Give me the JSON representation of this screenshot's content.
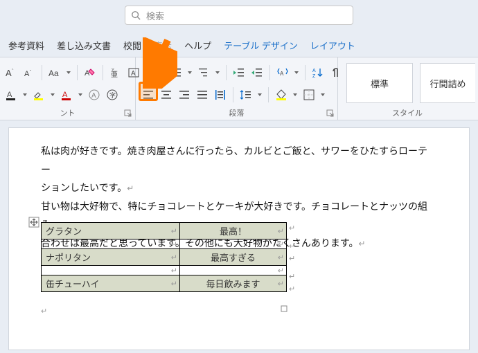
{
  "search": {
    "placeholder": "検索"
  },
  "tabs": [
    "参考資料",
    "差し込み文書",
    "校閲",
    "表示",
    "ヘルプ",
    "テーブル デザイン",
    "レイアウト"
  ],
  "groups": {
    "font": "ント",
    "para": "段落",
    "style": "スタイル"
  },
  "style": {
    "normal": "標準",
    "nospacing": "行間詰め"
  },
  "body": {
    "p1a": "私は肉が好きです。焼き肉屋さんに行ったら、カルビとご飯と、サワーをひたすらローテー",
    "p1b": "ションしたいです。",
    "p2a": "甘い物は大好物で、特にチョコレートとケーキが大好きです。チョコレートとナッツの組み",
    "p2b": "合わせは最高だと思っています。その他にも大好物がたくさんあります。"
  },
  "table": {
    "r1c1": "グラタン",
    "r1c2": "最高！",
    "r2c1": "ナポリタン",
    "r2c2": "最高すぎる",
    "r3c1": "缶チューハイ",
    "r3c2": "毎日飲みます"
  }
}
